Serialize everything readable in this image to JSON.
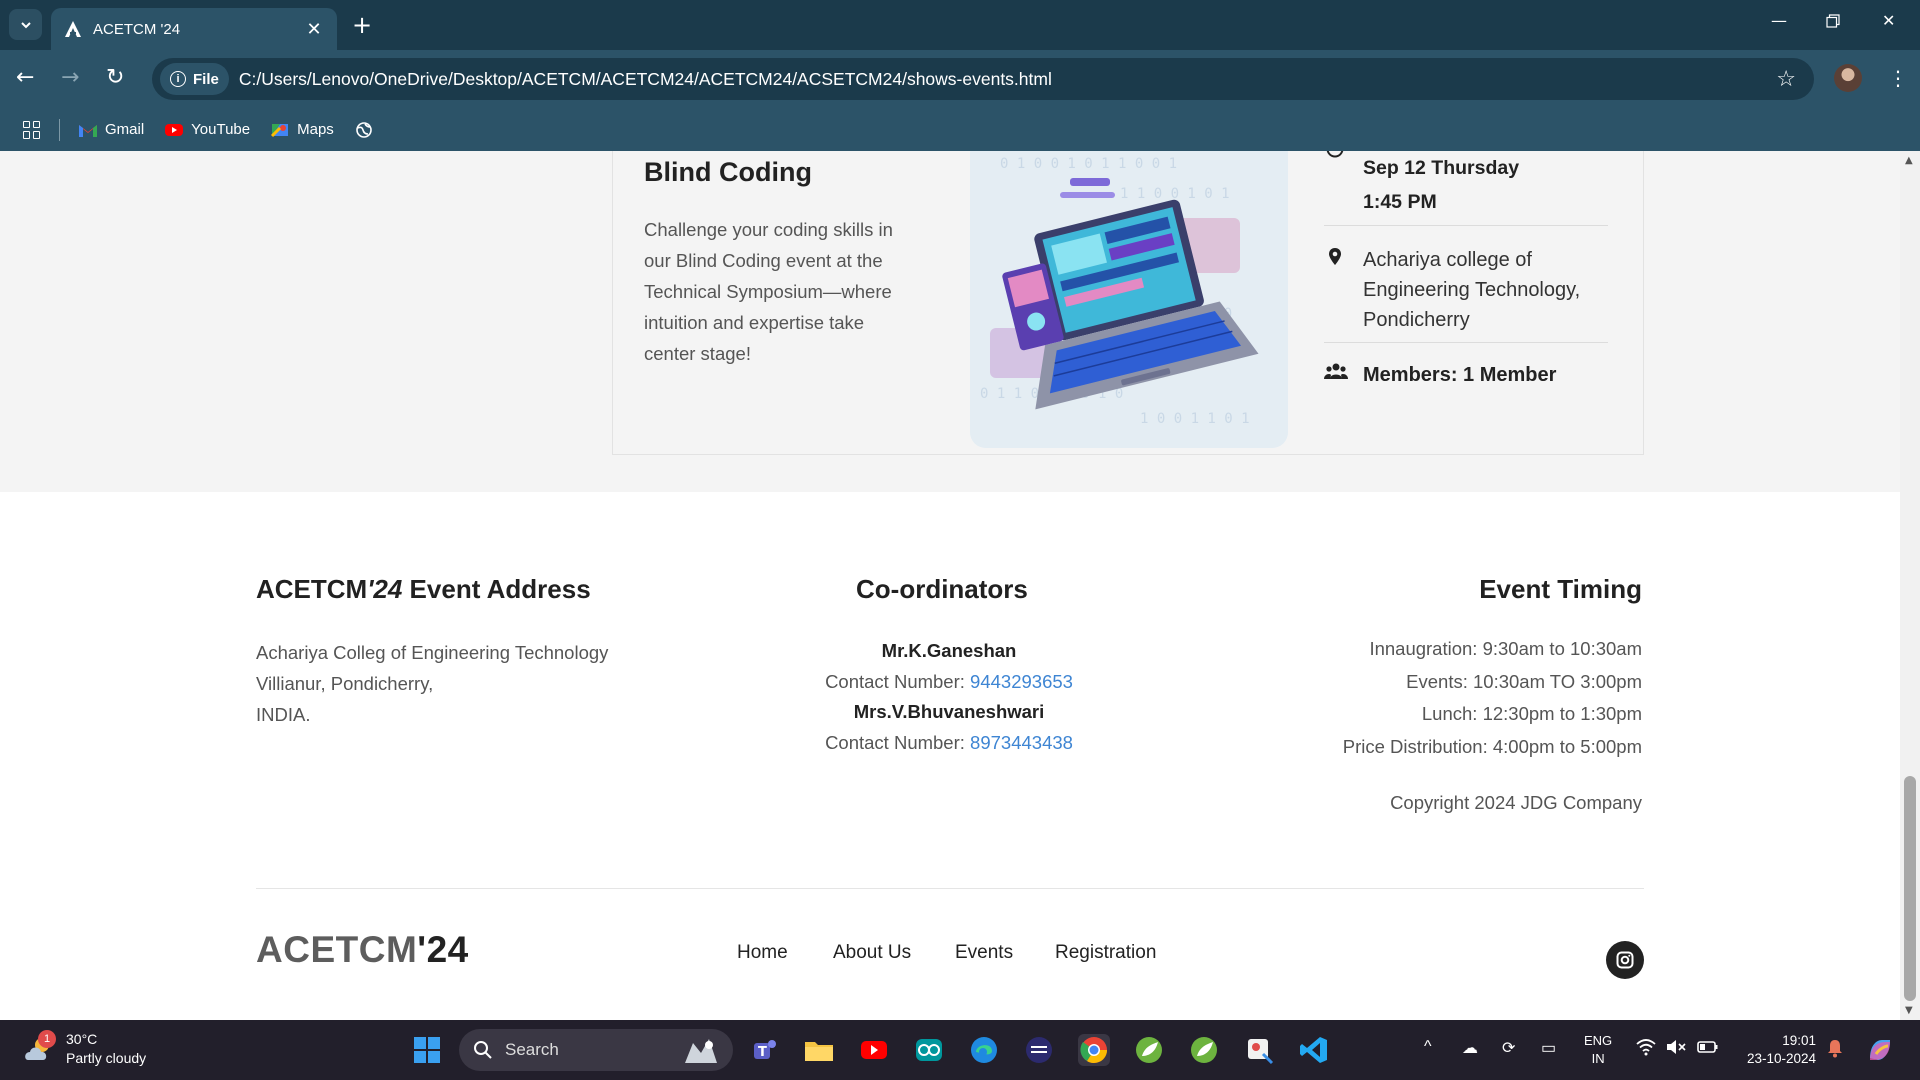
{
  "browser": {
    "tab_title": "ACETCM '24",
    "site_chip": "File",
    "url": "C:/Users/Lenovo/OneDrive/Desktop/ACETCM/ACETCM24/ACETCM24/ACSETCM24/shows-events.html",
    "new_tab": "+",
    "bookmarks": [
      {
        "label": "Gmail",
        "icon": "gmail-icon"
      },
      {
        "label": "YouTube",
        "icon": "youtube-icon"
      },
      {
        "label": "Maps",
        "icon": "maps-icon"
      }
    ]
  },
  "event": {
    "title": "Blind Coding",
    "description": "Challenge your coding skills in our Blind Coding event at the Technical Symposium—where intuition and expertise take center stage!",
    "date": "Sep 12 Thursday",
    "time": "1:45 PM",
    "venue": "Achariya college of Engineering Technology, Pondicherry",
    "members": "Members: 1 Member"
  },
  "footer": {
    "address": {
      "heading_prefix": "ACETCM",
      "heading_year": "'24",
      "heading_suffix": " Event Address",
      "lines": [
        "Achariya Colleg of Engineering Technology",
        "Villianur, Pondicherry,",
        "INDIA."
      ]
    },
    "coordinators": {
      "heading": "Co-ordinators",
      "people": [
        {
          "name": "Mr.K.Ganeshan",
          "contact_label": "Contact Number: ",
          "phone": "9443293653"
        },
        {
          "name": "Mrs.V.Bhuvaneshwari",
          "contact_label": "Contact Number: ",
          "phone": "8973443438"
        }
      ]
    },
    "timing": {
      "heading": "Event Timing",
      "lines": [
        "Innaugration: 9:30am to 10:30am",
        "Events: 10:30am TO 3:00pm",
        "Lunch: 12:30pm to 1:30pm",
        "Price Distribution: 4:00pm to 5:00pm"
      ]
    },
    "copyright": "Copyright 2024 JDG Company",
    "brand_prefix": "ACETCM",
    "brand_year": "'24",
    "nav": [
      "Home",
      "About Us",
      "Events",
      "Registration"
    ]
  },
  "taskbar": {
    "weather_temp": "30°C",
    "weather_desc": "Partly cloudy",
    "weather_badge": "1",
    "search_placeholder": "Search",
    "lang_1": "ENG",
    "lang_2": "IN",
    "time": "19:01",
    "date": "23-10-2024"
  },
  "colors": {
    "chrome_dark": "#1b3a4b",
    "chrome": "#2c5368",
    "link": "#3e85d3",
    "taskbar": "#221f2b"
  }
}
